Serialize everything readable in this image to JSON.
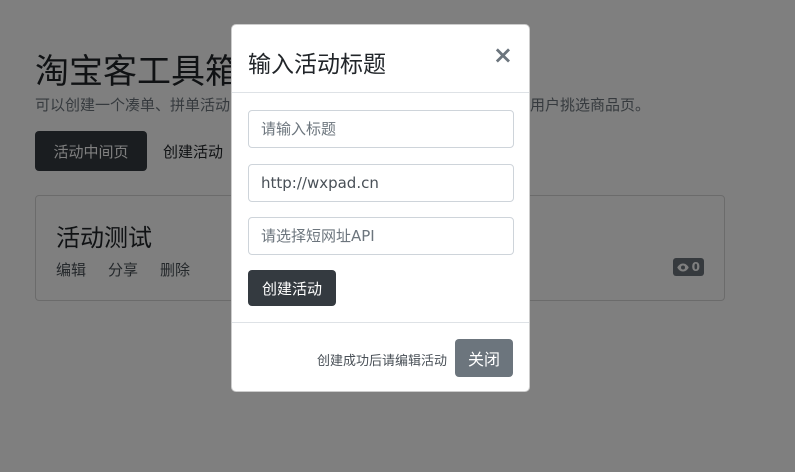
{
  "background": {
    "title": "淘宝客工具箱",
    "subtitle": "可以创建一个凑单、拼单活动的中间页，然后把链接发到群里或朋友圈，让用户挑选商品页。",
    "buttons": {
      "active": "活动中间页",
      "create": "创建活动"
    },
    "card": {
      "title": "活动测试",
      "actions": [
        "编辑",
        "分享",
        "删除"
      ],
      "views_icon": "eye-icon",
      "views_count": "0"
    }
  },
  "modal": {
    "title": "输入活动标题",
    "close_icon": "×",
    "fields": {
      "title_placeholder": "请输入标题",
      "url_value": "http://wxpad.cn",
      "api_placeholder": "请选择短网址API"
    },
    "create_button": "创建活动",
    "footer_note": "创建成功后请编辑活动",
    "close_button": "关闭"
  },
  "colors": {
    "dark_button": "#343a40",
    "secondary_button": "#6c757d",
    "backdrop": "rgba(0,0,0,0.5)"
  }
}
